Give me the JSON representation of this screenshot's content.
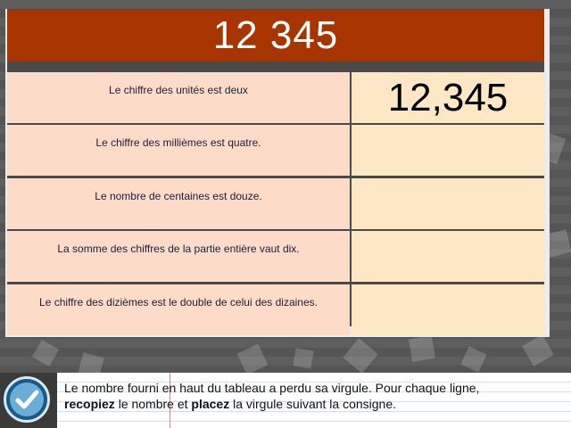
{
  "header": {
    "number": "12 345"
  },
  "rows": [
    {
      "instruction": "Le chiffre des unités est deux",
      "answer": "12,345"
    },
    {
      "instruction": "Le chiffre des millièmes est quatre.",
      "answer": ""
    },
    {
      "instruction": "Le nombre de centaines est douze.",
      "answer": ""
    },
    {
      "instruction": "La somme des chiffres de la partie entière vaut dix.",
      "answer": ""
    },
    {
      "instruction": "Le chiffre des dizièmes est le double de celui des dizaines.",
      "answer": ""
    }
  ],
  "footer": {
    "line1": "Le nombre fourni en haut du tableau a perdu sa virgule. Pour chaque ligne,",
    "bold1": "recopiez",
    "mid": " le nombre et ",
    "bold2": "placez",
    "end": " la virgule suivant la consigne."
  },
  "icons": {
    "validate": "checkmark-icon"
  },
  "colors": {
    "header": "#a83400",
    "left_cell": "#fcdcc8",
    "right_cell": "#fde7c4"
  }
}
